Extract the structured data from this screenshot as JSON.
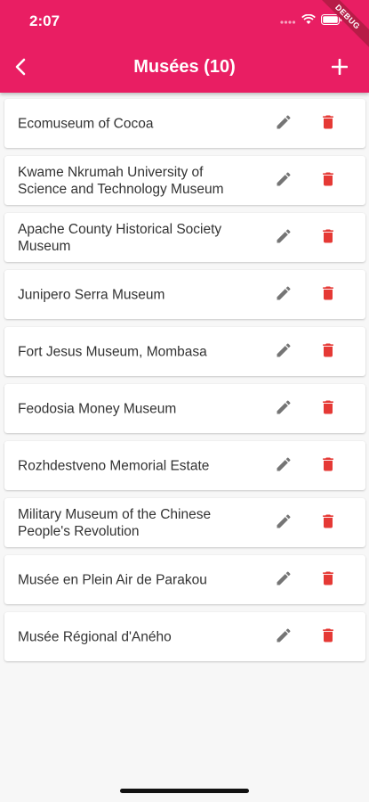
{
  "status_bar": {
    "time": "2:07"
  },
  "debug_banner": "DEBUG",
  "app_bar": {
    "title": "Musées (10)",
    "back_icon": "chevron-left-icon",
    "add_icon": "plus-icon"
  },
  "colors": {
    "primary": "#e91e63",
    "delete": "#e53935",
    "edit": "#757575",
    "background": "#f7f7f7"
  },
  "museums": [
    {
      "name": "Ecomuseum of Cocoa"
    },
    {
      "name": "Kwame Nkrumah University of Science and Technology Museum"
    },
    {
      "name": "Apache County Historical Society Museum"
    },
    {
      "name": "Junipero Serra Museum"
    },
    {
      "name": "Fort Jesus Museum, Mombasa"
    },
    {
      "name": "Feodosia Money Museum"
    },
    {
      "name": "Rozhdestveno Memorial Estate"
    },
    {
      "name": "Military Museum of the Chinese People's Revolution"
    },
    {
      "name": "Musée en Plein Air de Parakou"
    },
    {
      "name": "Musée Régional d'Aného"
    }
  ]
}
